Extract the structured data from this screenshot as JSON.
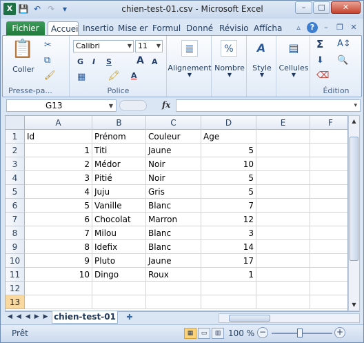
{
  "window": {
    "title": "chien-test-01.csv - Microsoft Excel",
    "controls": {
      "minimize": "–",
      "maximize": "□",
      "close": "✕"
    }
  },
  "qat": {
    "app_icon": "X",
    "save": "💾",
    "undo": "↶",
    "redo": "↷",
    "customize": "▾"
  },
  "tabs": [
    {
      "label": "Fichier"
    },
    {
      "label": "Accueil"
    },
    {
      "label": "Insertio"
    },
    {
      "label": "Mise er"
    },
    {
      "label": "Formul"
    },
    {
      "label": "Donné"
    },
    {
      "label": "Révisio"
    },
    {
      "label": "Affícha"
    }
  ],
  "ribbon": {
    "clipboard": {
      "label": "Presse-pa...",
      "paste_label": "Coller"
    },
    "font": {
      "label": "Police",
      "font_name": "Calibri",
      "font_size": "11",
      "bold": "G",
      "italic": "I",
      "underline": "S",
      "grow": "A",
      "shrink": "A"
    },
    "alignment": {
      "label": "Alignement"
    },
    "number": {
      "label": "Nombre",
      "icon_text": "%"
    },
    "style": {
      "label": "Style"
    },
    "cells": {
      "label": "Cellules"
    },
    "editing": {
      "label": "Édition",
      "sum": "Σ"
    }
  },
  "formula_bar": {
    "name_box": "G13",
    "fx": "fx",
    "formula": ""
  },
  "grid": {
    "columns": [
      "A",
      "B",
      "C",
      "D",
      "E",
      "F"
    ],
    "rows": [
      [
        "Id",
        "Prénom",
        "Couleur",
        "Age"
      ],
      [
        "1",
        "Titi",
        "Jaune",
        "5"
      ],
      [
        "2",
        "Médor",
        "Noir",
        "10"
      ],
      [
        "3",
        "Pitié",
        "Noir",
        "5"
      ],
      [
        "4",
        "Juju",
        "Gris",
        "5"
      ],
      [
        "5",
        "Vanille",
        "Blanc",
        "7"
      ],
      [
        "6",
        "Chocolat",
        "Marron",
        "12"
      ],
      [
        "7",
        "Milou",
        "Blanc",
        "3"
      ],
      [
        "8",
        "Idefix",
        "Blanc",
        "14"
      ],
      [
        "9",
        "Pluto",
        "Jaune",
        "17"
      ],
      [
        "10",
        "Dingo",
        "Roux",
        "1"
      ],
      [
        "",
        "",
        "",
        ""
      ],
      [
        "",
        "",
        "",
        ""
      ]
    ],
    "row_numbers": [
      "1",
      "2",
      "3",
      "4",
      "5",
      "6",
      "7",
      "8",
      "9",
      "10",
      "11",
      "12",
      "13"
    ],
    "selected_row": "13"
  },
  "sheets": {
    "active": "chien-test-01",
    "nav": "◀◀◀▶▶▶"
  },
  "status": {
    "ready": "Prêt",
    "zoom": "100 %",
    "zoom_minus": "−",
    "zoom_plus": "+"
  }
}
